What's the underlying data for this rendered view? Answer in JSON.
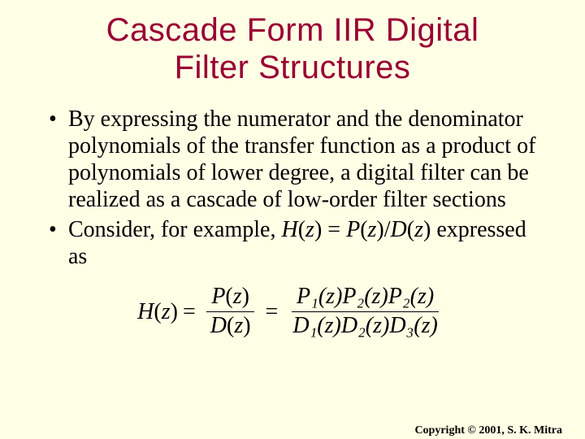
{
  "title_line1": "Cascade Form IIR Digital",
  "title_line2": "Filter Structures",
  "bullets": {
    "b1": "By expressing the numerator and the denominator polynomials of the transfer function as a product of polynomials of lower degree, a digital filter can be realized as a cascade of low-order filter sections",
    "b2_lead": "Consider, for example, ",
    "b2_expr_H": "H",
    "b2_expr_z": "z",
    "b2_expr_eq": " = ",
    "b2_expr_P": "P",
    "b2_expr_slash": "/",
    "b2_expr_D": "D",
    "b2_tail": " expressed as"
  },
  "equation": {
    "lhs_H": "H",
    "lhs_open": "(",
    "lhs_z": "z",
    "lhs_close": ")",
    "eq": "=",
    "frac1_num_P": "P",
    "frac1_num_open": "(",
    "frac1_num_z": "z",
    "frac1_num_close": ")",
    "frac1_den_D": "D",
    "frac1_den_open": "(",
    "frac1_den_z": "z",
    "frac1_den_close": ")",
    "frac2_num": "P₁(z)P₂(z)P₂(z)",
    "frac2_den": "D₁(z)D₂(z)D₃(z)"
  },
  "copyright": "Copyright © 2001, S. K. Mitra"
}
